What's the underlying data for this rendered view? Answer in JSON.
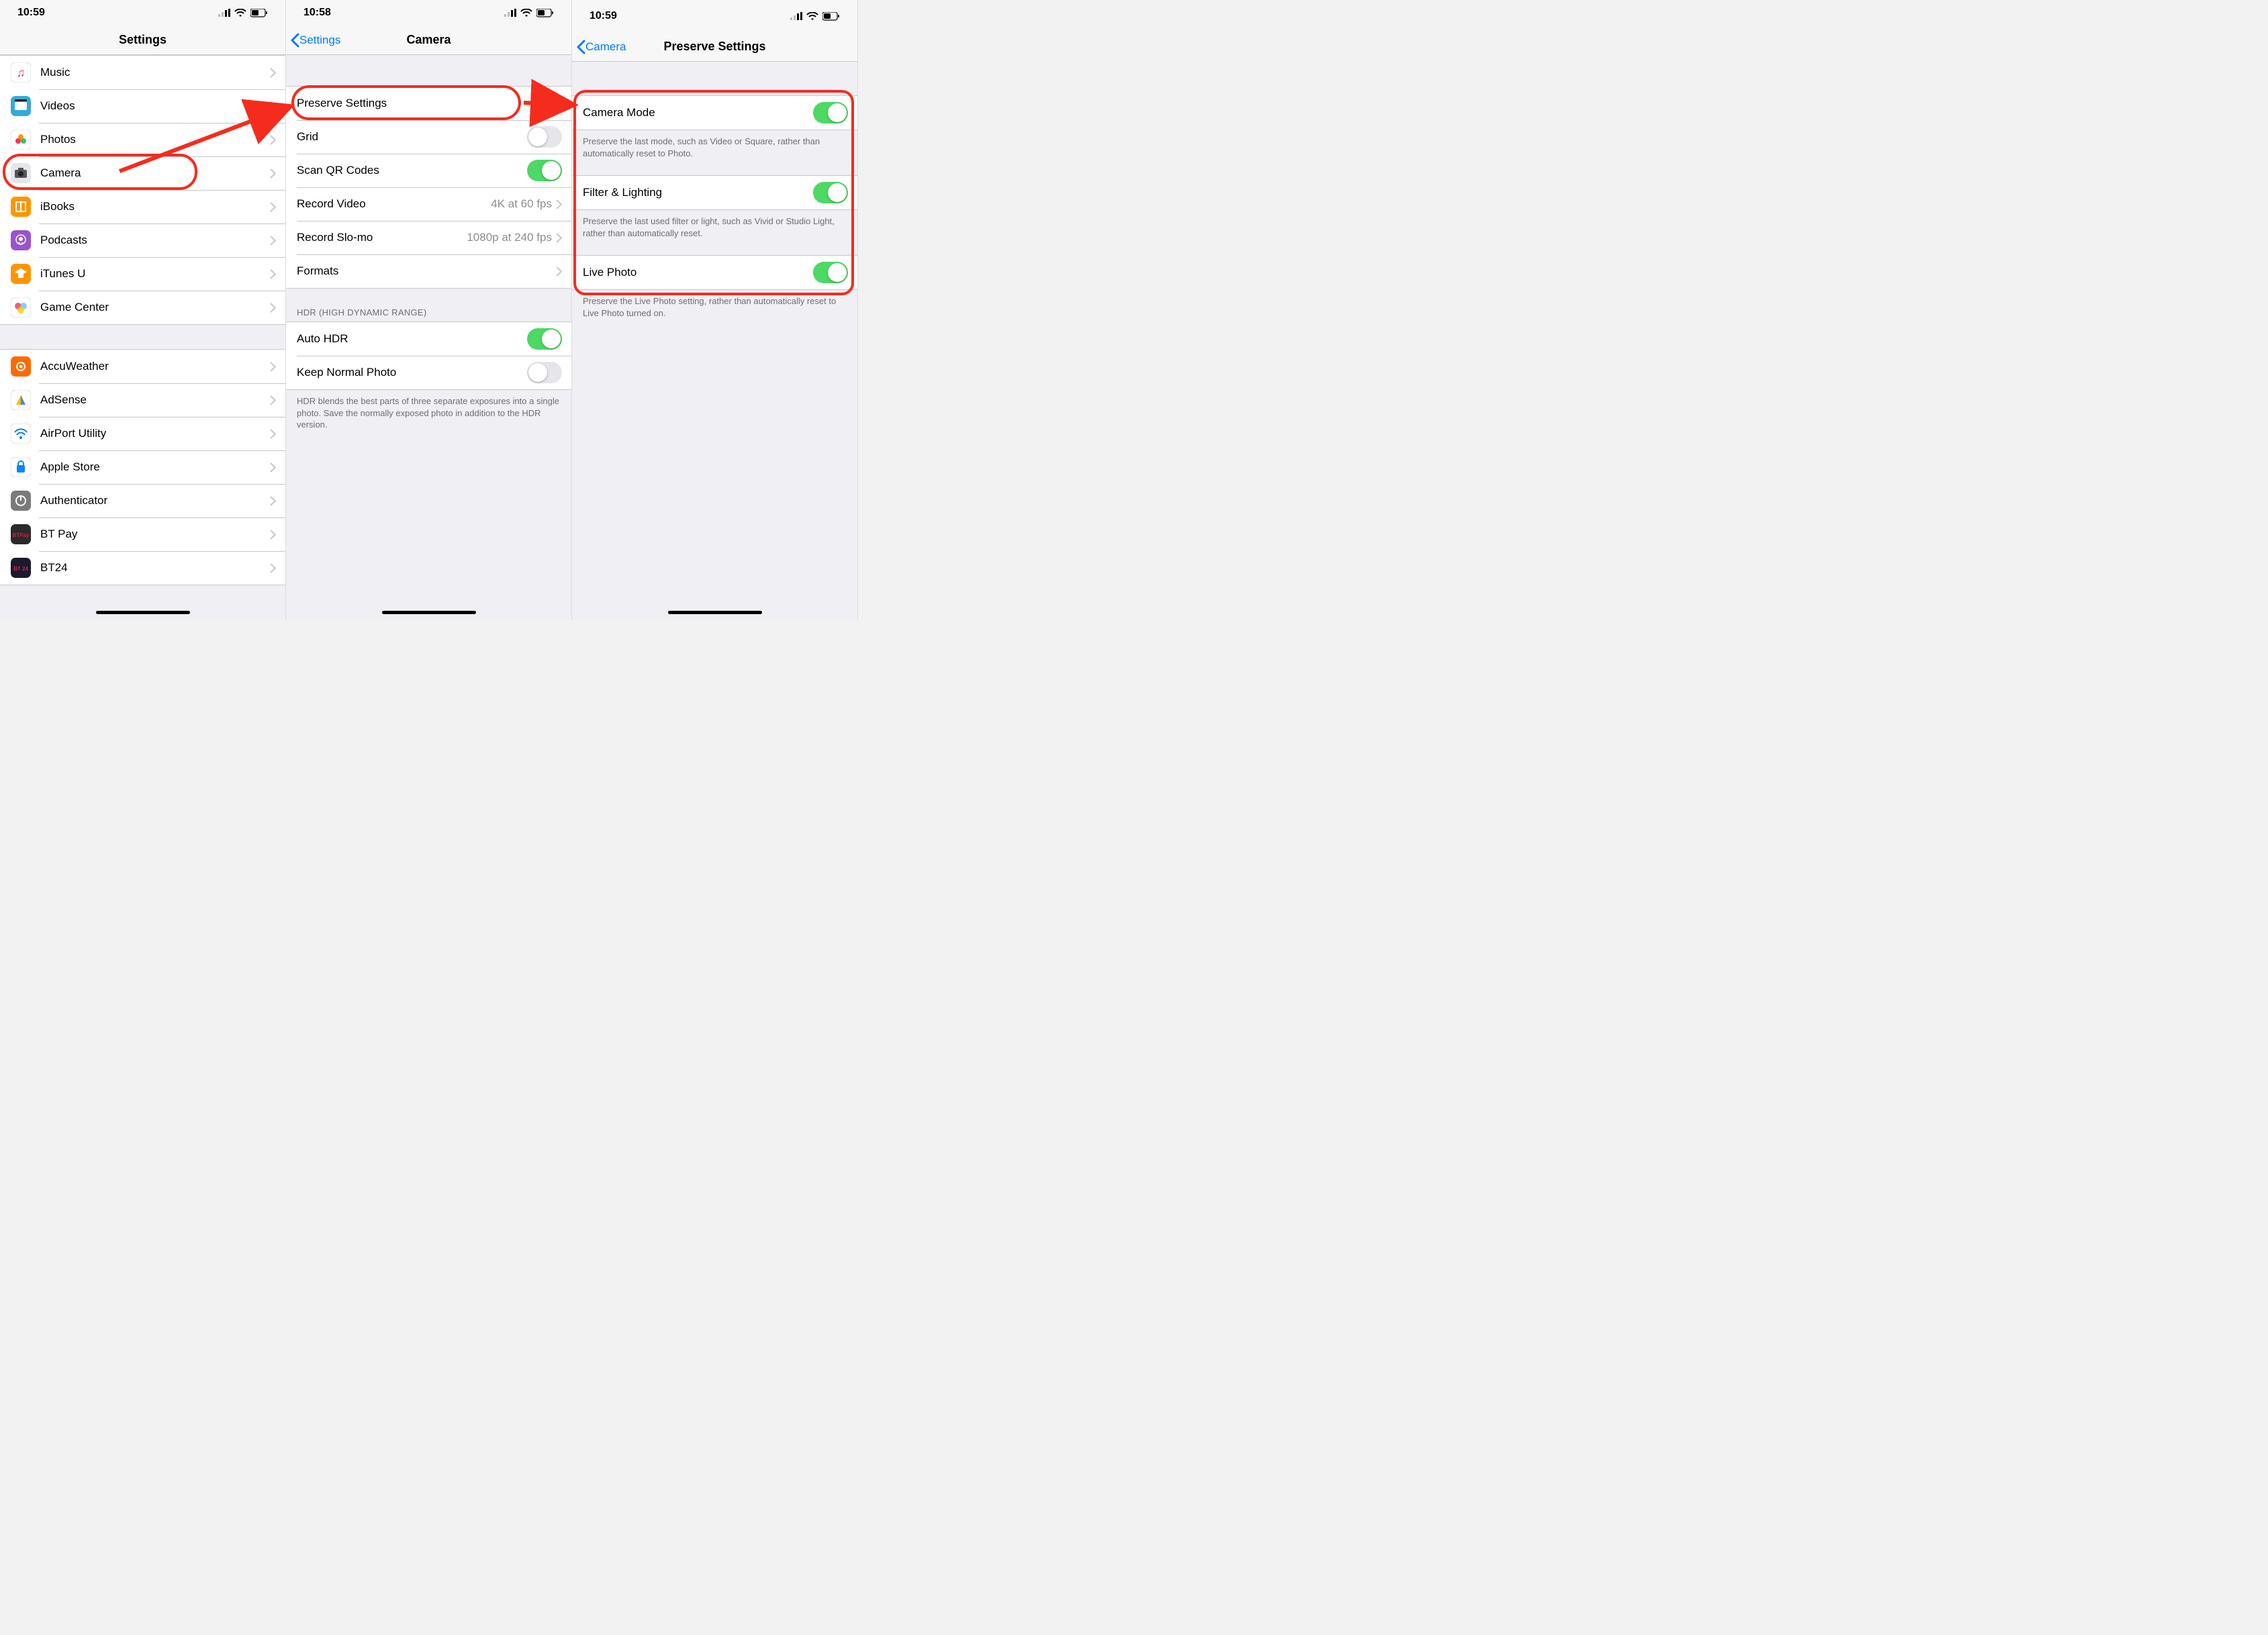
{
  "screen1": {
    "time": "10:59",
    "title": "Settings",
    "group1": [
      {
        "label": "Music",
        "icon": "music",
        "bg": "#fff"
      },
      {
        "label": "Videos",
        "icon": "videos",
        "bg": "#fff"
      },
      {
        "label": "Photos",
        "icon": "photos",
        "bg": "#fff"
      },
      {
        "label": "Camera",
        "icon": "camera",
        "bg": "#eee"
      },
      {
        "label": "iBooks",
        "icon": "ibooks",
        "bg": "#ff9500"
      },
      {
        "label": "Podcasts",
        "icon": "podcasts",
        "bg": "#9a52d1"
      },
      {
        "label": "iTunes U",
        "icon": "itunesu",
        "bg": "#ff9500"
      },
      {
        "label": "Game Center",
        "icon": "gamecenter",
        "bg": "#fff"
      }
    ],
    "group2": [
      {
        "label": "AccuWeather",
        "icon": "accu",
        "bg": "#ff3b30"
      },
      {
        "label": "AdSense",
        "icon": "adsense",
        "bg": "#fff"
      },
      {
        "label": "AirPort Utility",
        "icon": "airport",
        "bg": "#fff"
      },
      {
        "label": "Apple Store",
        "icon": "applestore",
        "bg": "#fff"
      },
      {
        "label": "Authenticator",
        "icon": "auth",
        "bg": "#7a7a7a"
      },
      {
        "label": "BT Pay",
        "icon": "btpay",
        "bg": "#2a2a2a"
      },
      {
        "label": "BT24",
        "icon": "bt24",
        "bg": "#1a1a2e"
      }
    ]
  },
  "screen2": {
    "time": "10:58",
    "back": "Settings",
    "title": "Camera",
    "rows1": {
      "preserve": "Preserve Settings",
      "grid": "Grid",
      "grid_on": false,
      "scanqr": "Scan QR Codes",
      "scanqr_on": true,
      "recvideo": "Record Video",
      "recvideo_val": "4K at 60 fps",
      "recslomo": "Record Slo-mo",
      "recslomo_val": "1080p at 240 fps",
      "formats": "Formats"
    },
    "hdr_header": "HDR (HIGH DYNAMIC RANGE)",
    "rows2": {
      "autohdr": "Auto HDR",
      "autohdr_on": true,
      "keepnormal": "Keep Normal Photo",
      "keepnormal_on": false
    },
    "hdr_footer": "HDR blends the best parts of three separate exposures into a single photo. Save the normally exposed photo in addition to the HDR version."
  },
  "screen3": {
    "time": "10:59",
    "back": "Camera",
    "title": "Preserve Settings",
    "rows": {
      "cameramode": "Camera Mode",
      "cameramode_on": true,
      "cameramode_foot": "Preserve the last mode, such as Video or Square, rather than automatically reset to Photo.",
      "filter": "Filter & Lighting",
      "filter_on": true,
      "filter_foot": "Preserve the last used filter or light, such as Vivid or Studio Light, rather than automatically reset.",
      "livephoto": "Live Photo",
      "livephoto_on": true,
      "livephoto_foot": "Preserve the Live Photo setting, rather than automatically reset to Live Photo turned on."
    }
  }
}
